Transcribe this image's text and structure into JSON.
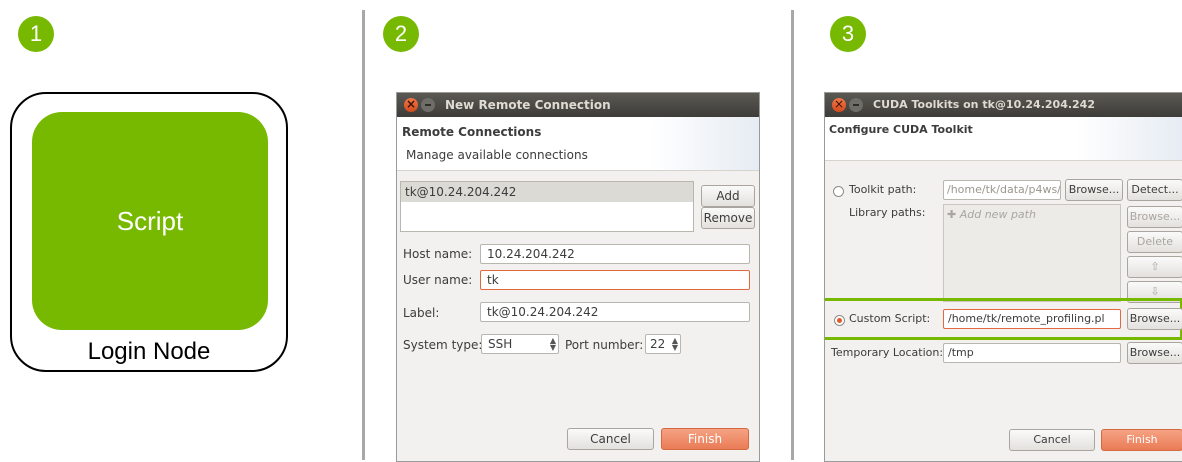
{
  "steps": [
    "1",
    "2",
    "3"
  ],
  "panel1": {
    "script_label": "Script",
    "node_label": "Login Node"
  },
  "panel2": {
    "window_title": "New Remote Connection",
    "header_title": "Remote Connections",
    "header_subtitle": "Manage available connections",
    "connections": [
      "tk@10.24.204.242"
    ],
    "add_label": "Add",
    "remove_label": "Remove",
    "host_label": "Host name:",
    "host_value": "10.24.204.242",
    "user_label": "User name:",
    "user_value": "tk",
    "label_label": "Label:",
    "label_value": "tk@10.24.204.242",
    "system_type_label": "System type:",
    "system_type_value": "SSH",
    "port_label": "Port number:",
    "port_value": "22",
    "cancel_label": "Cancel",
    "finish_label": "Finish"
  },
  "panel3": {
    "window_title": "CUDA Toolkits on tk@10.24.204.242",
    "header_title": "Configure CUDA Toolkit",
    "toolkit_path_label": "Toolkit path:",
    "toolkit_path_value": "/home/tk/data/p4ws/",
    "browse_label": "Browse...",
    "detect_label": "Detect...",
    "library_paths_label": "Library paths:",
    "add_new_path_placeholder": "Add new path",
    "delete_label": "Delete",
    "custom_script_label": "Custom Script:",
    "custom_script_value": "/home/tk/remote_profiling.pl",
    "temp_location_label": "Temporary Location:",
    "temp_location_value": "/tmp",
    "cancel_label": "Cancel",
    "finish_label": "Finish"
  },
  "colors": {
    "accent": "#76b900",
    "finish": "#ea7b56",
    "titlebar": "#4a4945"
  }
}
